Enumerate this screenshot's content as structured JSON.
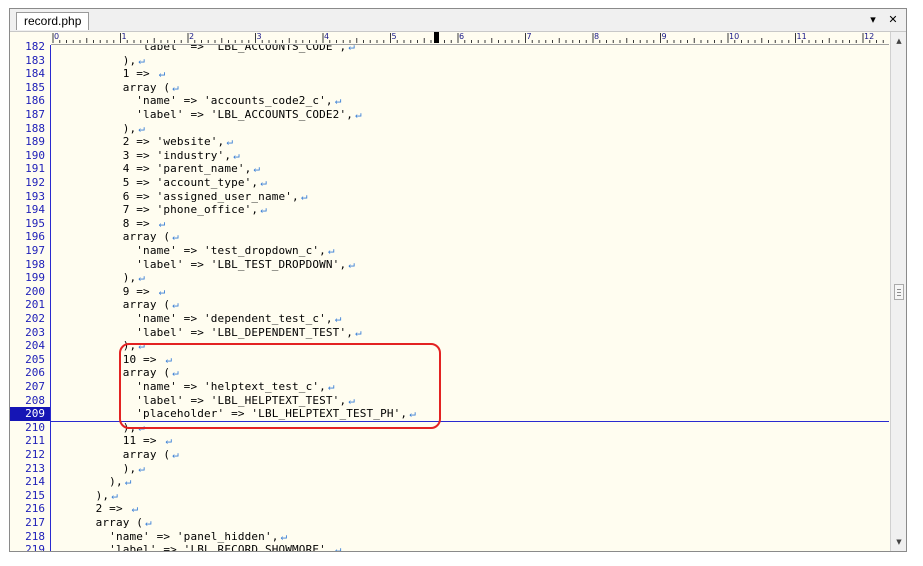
{
  "tab": {
    "title": "record.php"
  },
  "window_controls": {
    "dropdown": "▾",
    "close": "✕"
  },
  "ruler": {
    "marks": [
      "0",
      "1",
      "2",
      "3",
      "4",
      "5",
      "6",
      "7",
      "8",
      "9",
      "10",
      "11",
      "12"
    ]
  },
  "editor": {
    "current_line": 209,
    "eol_glyph": "↵",
    "lines": [
      {
        "num": "182",
        "text": "            'label' => 'LBL_ACCOUNTS_CODE',"
      },
      {
        "num": "183",
        "text": "          ),"
      },
      {
        "num": "184",
        "text": "          1 => "
      },
      {
        "num": "185",
        "text": "          array ("
      },
      {
        "num": "186",
        "text": "            'name' => 'accounts_code2_c',"
      },
      {
        "num": "187",
        "text": "            'label' => 'LBL_ACCOUNTS_CODE2',"
      },
      {
        "num": "188",
        "text": "          ),"
      },
      {
        "num": "189",
        "text": "          2 => 'website',"
      },
      {
        "num": "190",
        "text": "          3 => 'industry',"
      },
      {
        "num": "191",
        "text": "          4 => 'parent_name',"
      },
      {
        "num": "192",
        "text": "          5 => 'account_type',"
      },
      {
        "num": "193",
        "text": "          6 => 'assigned_user_name',"
      },
      {
        "num": "194",
        "text": "          7 => 'phone_office',"
      },
      {
        "num": "195",
        "text": "          8 => "
      },
      {
        "num": "196",
        "text": "          array ("
      },
      {
        "num": "197",
        "text": "            'name' => 'test_dropdown_c',"
      },
      {
        "num": "198",
        "text": "            'label' => 'LBL_TEST_DROPDOWN',"
      },
      {
        "num": "199",
        "text": "          ),"
      },
      {
        "num": "200",
        "text": "          9 => "
      },
      {
        "num": "201",
        "text": "          array ("
      },
      {
        "num": "202",
        "text": "            'name' => 'dependent_test_c',"
      },
      {
        "num": "203",
        "text": "            'label' => 'LBL_DEPENDENT_TEST',"
      },
      {
        "num": "204",
        "text": "          ),"
      },
      {
        "num": "205",
        "text": "          10 => "
      },
      {
        "num": "206",
        "text": "          array ("
      },
      {
        "num": "207",
        "text": "            'name' => 'helptext_test_c',"
      },
      {
        "num": "208",
        "text": "            'label' => 'LBL_HELPTEXT_TEST',"
      },
      {
        "num": "209",
        "text": "            'placeholder' => 'LBL_HELPTEXT_TEST_PH',"
      },
      {
        "num": "210",
        "text": "          ),"
      },
      {
        "num": "211",
        "text": "          11 => "
      },
      {
        "num": "212",
        "text": "          array ("
      },
      {
        "num": "213",
        "text": "          ),"
      },
      {
        "num": "214",
        "text": "        ),"
      },
      {
        "num": "215",
        "text": "      ),"
      },
      {
        "num": "216",
        "text": "      2 => "
      },
      {
        "num": "217",
        "text": "      array ("
      },
      {
        "num": "218",
        "text": "        'name' => 'panel_hidden',"
      },
      {
        "num": "219",
        "text": "        'label' => 'LBL_RECORD_SHOWMORE',"
      }
    ]
  },
  "scrollbar": {
    "up_arrow": "▲",
    "down_arrow": "▼"
  },
  "colors": {
    "highlight_box": "#e32222",
    "line_number": "#2020b8",
    "eol_mark": "#3a7fd6",
    "editor_bg": "#fffdf0"
  }
}
